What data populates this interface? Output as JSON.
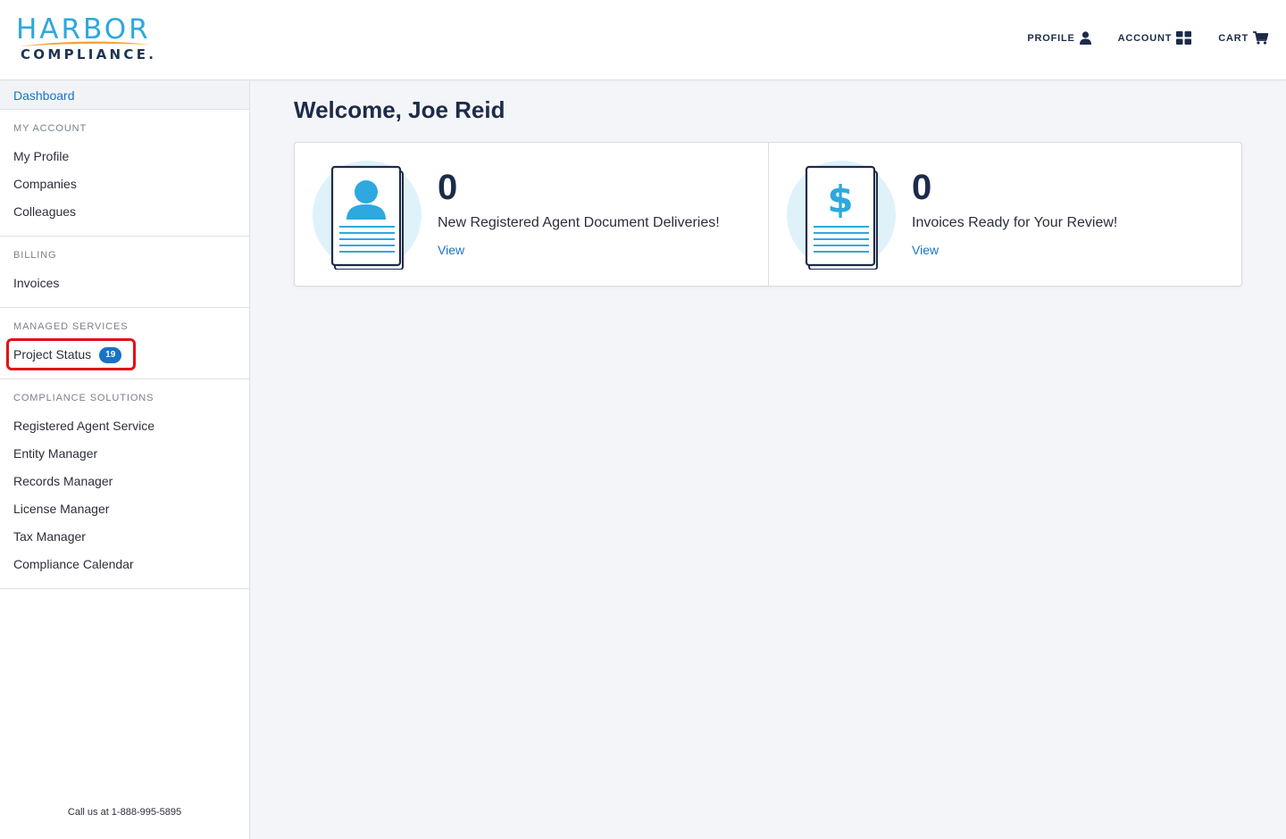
{
  "brand": {
    "logo_top": "HARBOR",
    "logo_bottom": "COMPLIANCE."
  },
  "topnav": {
    "profile_label": "PROFILE",
    "account_label": "ACCOUNT",
    "cart_label": "CART"
  },
  "sidebar": {
    "dashboard_label": "Dashboard",
    "my_account": {
      "heading": "MY ACCOUNT",
      "items": [
        "My Profile",
        "Companies",
        "Colleagues"
      ]
    },
    "billing": {
      "heading": "BILLING",
      "items": [
        "Invoices"
      ]
    },
    "managed_services": {
      "heading": "MANAGED SERVICES",
      "project_status_label": "Project Status",
      "project_status_count": "19"
    },
    "compliance_solutions": {
      "heading": "COMPLIANCE SOLUTIONS",
      "items": [
        "Registered Agent Service",
        "Entity Manager",
        "Records Manager",
        "License Manager",
        "Tax Manager",
        "Compliance Calendar"
      ]
    },
    "footer": "Call us at 1-888-995-5895"
  },
  "main": {
    "welcome": "Welcome, Joe Reid",
    "cards": [
      {
        "count": "0",
        "text": "New Registered Agent Document Deliveries!",
        "link": "View",
        "icon": "person-document-icon"
      },
      {
        "count": "0",
        "text": "Invoices Ready for Your Review!",
        "link": "View",
        "icon": "dollar-document-icon"
      }
    ]
  },
  "colors": {
    "accent_blue": "#1a73c8",
    "navy": "#1d2b4a",
    "logo_blue": "#2ea8de",
    "highlight_red": "#e0121a",
    "illustration_light": "#dff2fa"
  }
}
